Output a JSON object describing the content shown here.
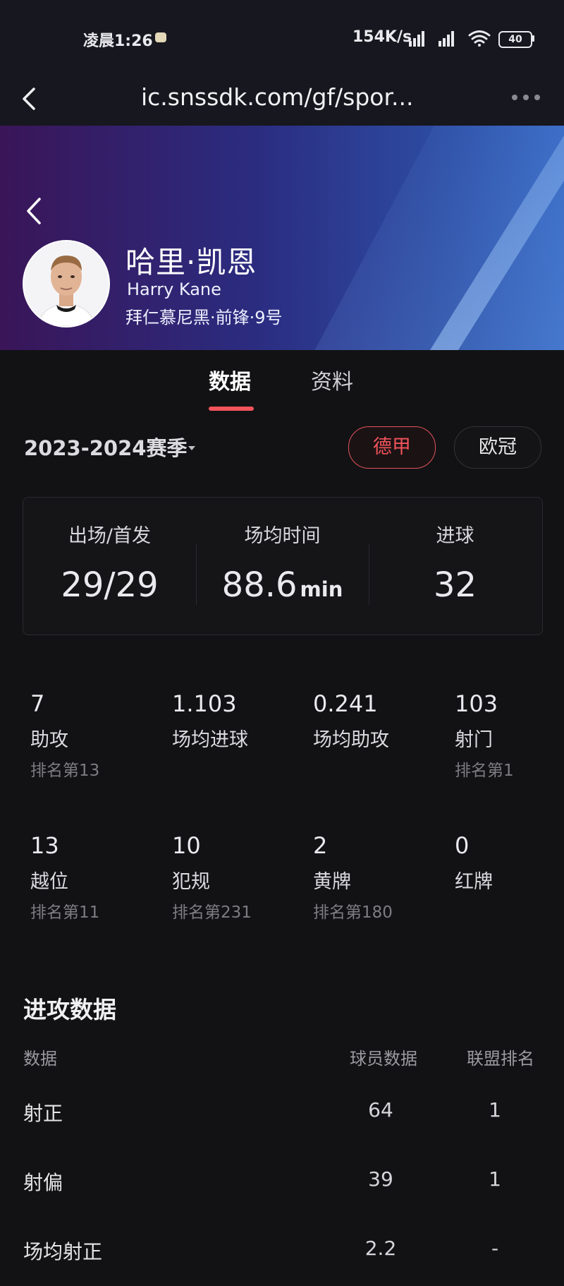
{
  "status": {
    "time": "凌晨1:26",
    "network_speed": "154K/s",
    "battery": "40"
  },
  "browser": {
    "url": "ic.snssdk.com/gf/spor..."
  },
  "player": {
    "name_cn": "哈里·凯恩",
    "name_en": "Harry Kane",
    "meta": "拜仁慕尼黑·前锋·9号"
  },
  "tabs": [
    {
      "label": "数据",
      "active": true
    },
    {
      "label": "资料",
      "active": false
    }
  ],
  "season": {
    "label": "2023-2024赛季",
    "leagues": [
      {
        "label": "德甲",
        "selected": true
      },
      {
        "label": "欧冠",
        "selected": false
      }
    ]
  },
  "summary": [
    {
      "label": "出场/首发",
      "value": "29/29",
      "unit": ""
    },
    {
      "label": "场均时间",
      "value": "88.6",
      "unit": "min"
    },
    {
      "label": "进球",
      "value": "32",
      "unit": ""
    }
  ],
  "stats_grid": [
    {
      "value": "7",
      "label": "助攻",
      "rank": "排名第13"
    },
    {
      "value": "1.103",
      "label": "场均进球",
      "rank": ""
    },
    {
      "value": "0.241",
      "label": "场均助攻",
      "rank": ""
    },
    {
      "value": "103",
      "label": "射门",
      "rank": "排名第1"
    },
    {
      "value": "13",
      "label": "越位",
      "rank": "排名第11"
    },
    {
      "value": "10",
      "label": "犯规",
      "rank": "排名第231"
    },
    {
      "value": "2",
      "label": "黄牌",
      "rank": "排名第180"
    },
    {
      "value": "0",
      "label": "红牌",
      "rank": ""
    }
  ],
  "attack_section": {
    "title": "进攻数据",
    "headers": [
      "数据",
      "球员数据",
      "联盟排名"
    ],
    "rows": [
      {
        "name": "射正",
        "value": "64",
        "rank": "1"
      },
      {
        "name": "射偏",
        "value": "39",
        "rank": "1"
      },
      {
        "name": "场均射正",
        "value": "2.2",
        "rank": "-"
      }
    ]
  },
  "colors": {
    "accent": "#f2545b",
    "background": "#121214",
    "hero_start": "#3a1558",
    "hero_end": "#3566c1"
  }
}
